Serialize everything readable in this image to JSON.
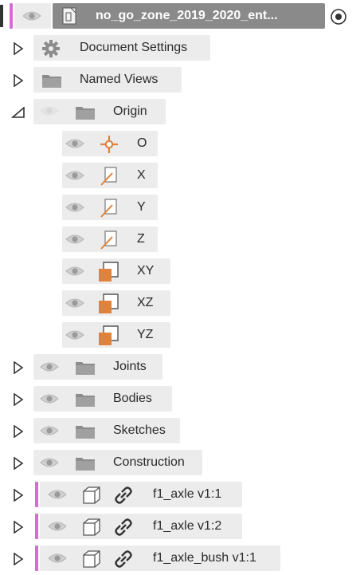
{
  "browser": {
    "root": {
      "label": "no_go_zone_2019_2020_ent..."
    },
    "items": [
      {
        "label": "Document Settings"
      },
      {
        "label": "Named Views"
      },
      {
        "label": "Origin"
      },
      {
        "label": "O"
      },
      {
        "label": "X"
      },
      {
        "label": "Y"
      },
      {
        "label": "Z"
      },
      {
        "label": "XY"
      },
      {
        "label": "XZ"
      },
      {
        "label": "YZ"
      },
      {
        "label": "Joints"
      },
      {
        "label": "Bodies"
      },
      {
        "label": "Sketches"
      },
      {
        "label": "Construction"
      },
      {
        "label": "f1_axle v1:1"
      },
      {
        "label": "f1_axle v1:2"
      },
      {
        "label": "f1_axle_bush v1:1"
      }
    ]
  },
  "colors": {
    "accent_pink": "#d66ad8",
    "origin_orange": "#e0823c",
    "folder_gray": "#8c8c8c",
    "root_bg": "#8a8a8a"
  },
  "icons": {
    "expand": "triangle-right-outline",
    "collapse": "triangle-down-left",
    "visibility": "eye-icon",
    "folder": "folder-icon",
    "gear": "gear-icon",
    "component": "cube-outline-icon",
    "link": "chain-link-icon",
    "activate": "radio-target-icon"
  }
}
